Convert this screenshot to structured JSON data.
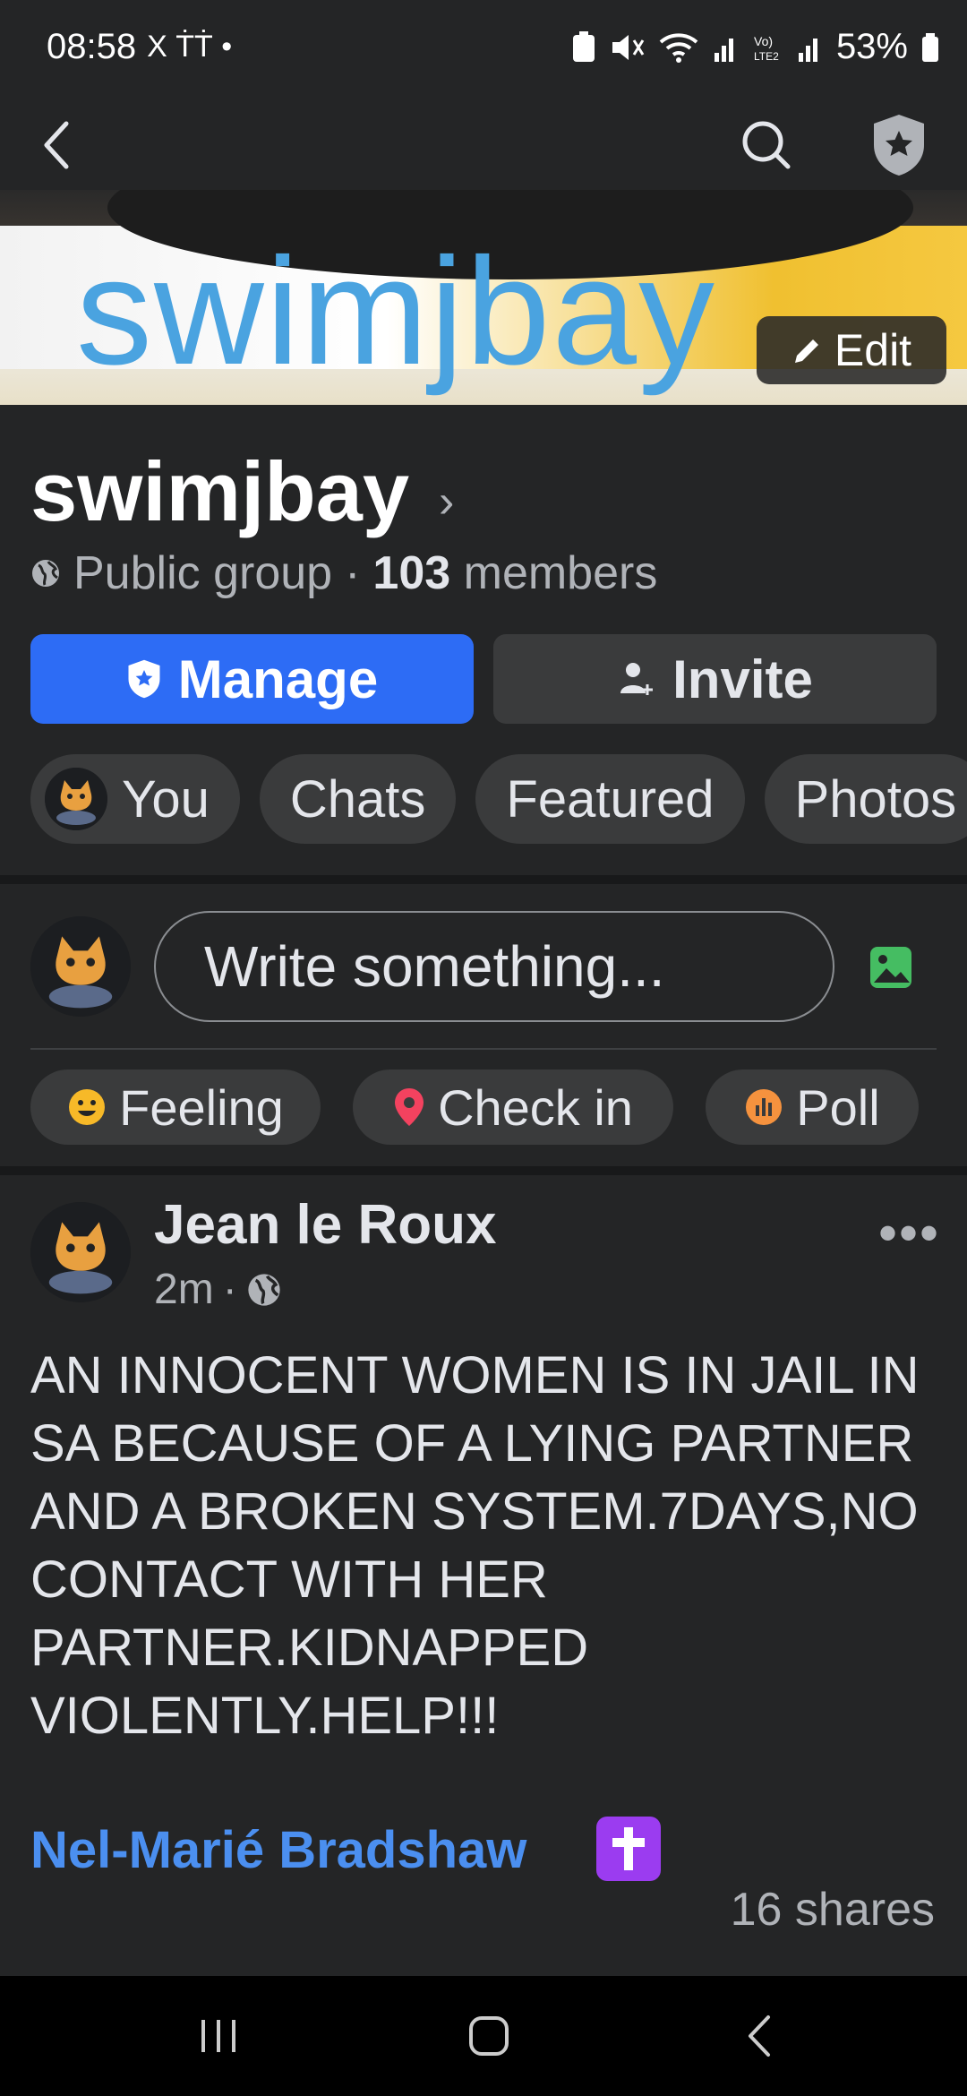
{
  "status_bar": {
    "time": "08:58",
    "left_glyphs": "X ṪṪ •",
    "battery": "53%"
  },
  "nav": {
    "back_icon": "chevron-left-icon",
    "search_icon": "search-icon",
    "admin_icon": "shield-star-icon"
  },
  "cover": {
    "text": "swimjbay",
    "edit_label": "Edit"
  },
  "group": {
    "name": "swimjbay",
    "privacy": "Public group",
    "separator": "·",
    "member_count": "103",
    "members_label": "members"
  },
  "buttons": {
    "manage": "Manage",
    "invite": "Invite"
  },
  "tabs": [
    "You",
    "Chats",
    "Featured",
    "Photos"
  ],
  "composer": {
    "placeholder": "Write something..."
  },
  "actions": {
    "feeling": "Feeling",
    "check_in": "Check in",
    "poll": "Poll"
  },
  "post": {
    "author": "Jean le Roux",
    "time": "2m",
    "separator": "·",
    "body": "AN INNOCENT WOMEN IS IN JAIL IN SA BECAUSE OF A LYING PARTNER AND A BROKEN SYSTEM.7DAYS,NO CONTACT WITH HER PARTNER.KIDNAPPED VIOLENTLY.HELP!!!",
    "tagged_name": "Nel-Marié Bradshaw",
    "shares": "16 shares",
    "more": "•••"
  },
  "colors": {
    "primary_blue": "#2d6cf5",
    "link_blue": "#4b8ff0",
    "background": "#242526",
    "chip": "#3a3b3c"
  }
}
